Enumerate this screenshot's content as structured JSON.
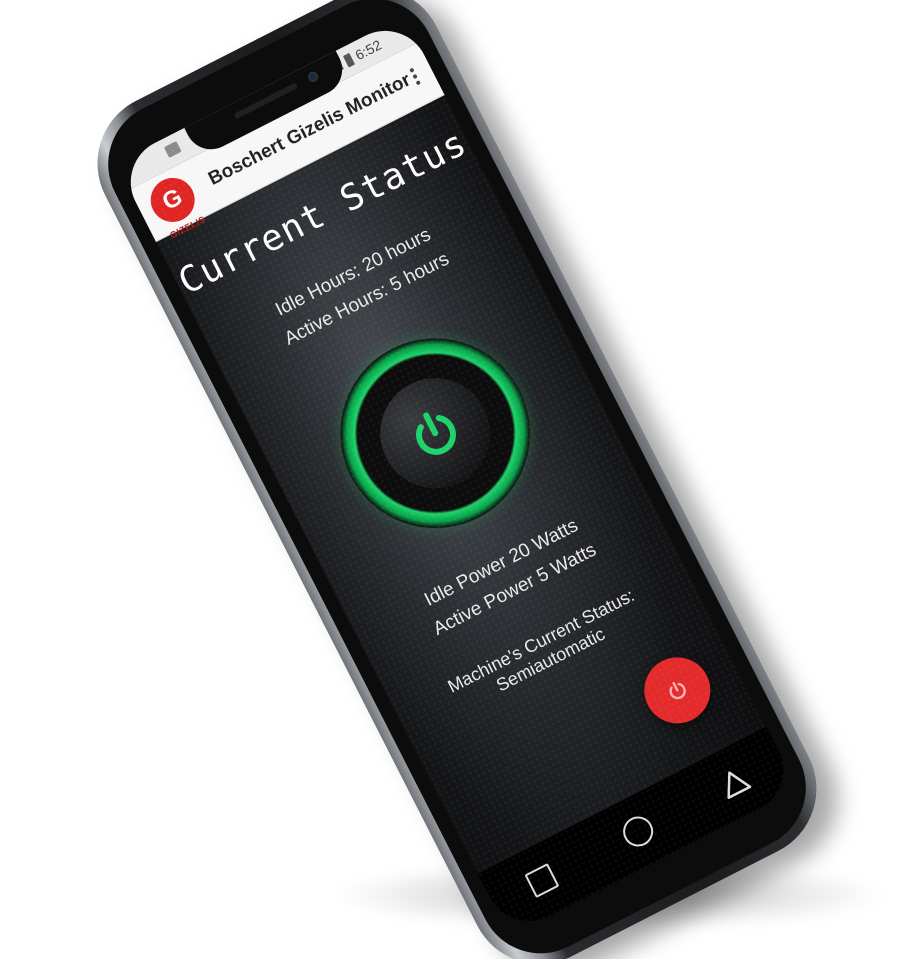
{
  "statusbar": {
    "time": "6:52",
    "icons": [
      "notification-icon",
      "signal-icon",
      "battery-icon"
    ]
  },
  "appbar": {
    "logo_letter": "G",
    "logo_text": "GIZELIS",
    "title": "Boschert Gizelis Monitor",
    "menu_icon": "overflow-menu-icon"
  },
  "main": {
    "heading": "Current Status",
    "idle_hours": "Idle Hours:  20 hours",
    "active_hours": "Active Hours:  5 hours",
    "power_button_icon": "power-icon",
    "idle_power": "Idle Power  20 Watts",
    "active_power": "Active Power  5 Watts",
    "machine_status": "Machine's Current Status: Semiautomatic"
  },
  "fab": {
    "icon": "power-icon"
  },
  "navbar": {
    "buttons": [
      "recents-square-icon",
      "home-circle-icon",
      "back-triangle-icon"
    ]
  },
  "colors": {
    "accent_green": "#1ed36a",
    "fab_red": "#e32b2b",
    "logo_red": "#e02525",
    "appbar_bg": "#f7f7f7"
  }
}
